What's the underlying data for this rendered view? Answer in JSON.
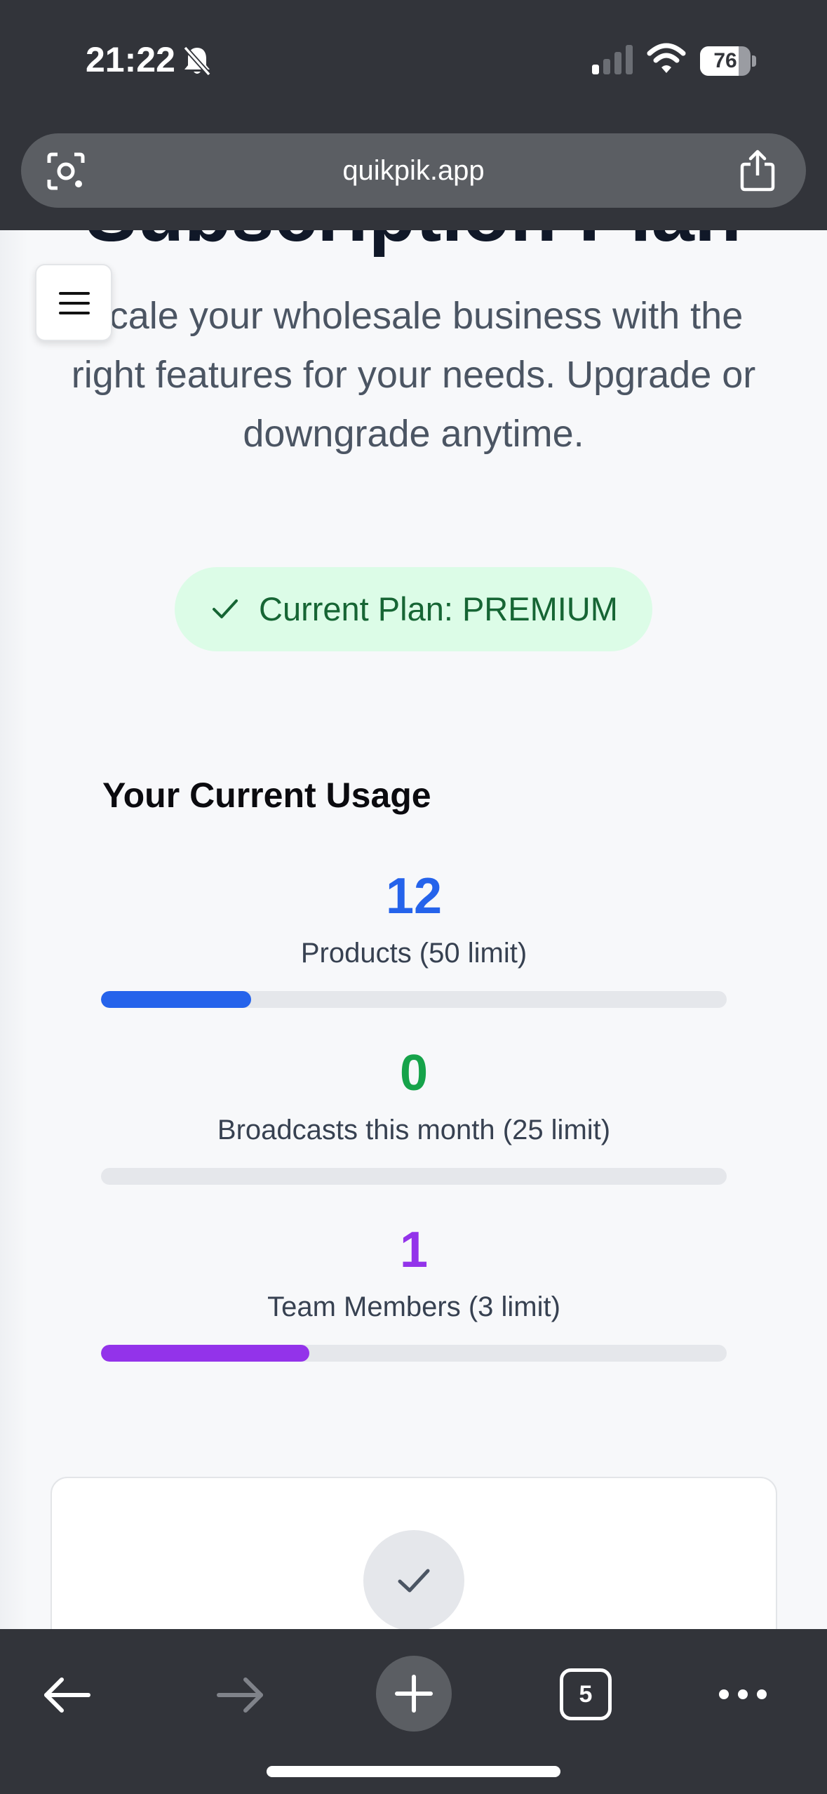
{
  "status_bar": {
    "time": "21:22",
    "battery_level": "76",
    "battery_fraction": 0.76,
    "icons": [
      "bell-slash-icon",
      "cellular-signal-icon",
      "wifi-icon",
      "battery-icon"
    ]
  },
  "browser": {
    "url": "quikpik.app",
    "tab_count": "5",
    "icons": [
      "lens-icon",
      "share-icon",
      "back-icon",
      "forward-icon",
      "plus-icon",
      "tabs-icon",
      "more-icon"
    ]
  },
  "page": {
    "title": "Subscription Plan",
    "subtitle": "Scale your wholesale business with the right features for your needs. Upgrade or downgrade anytime.",
    "current_plan": "Current Plan: PREMIUM",
    "usage_heading": "Your Current Usage"
  },
  "usage": [
    {
      "value": "12",
      "label": "Products (50 limit)",
      "used": 12,
      "limit": 50,
      "color": "#2563eb"
    },
    {
      "value": "0",
      "label": "Broadcasts this month (25 limit)",
      "used": 0,
      "limit": 25,
      "color": "#16a34a"
    },
    {
      "value": "1",
      "label": "Team Members (3 limit)",
      "used": 1,
      "limit": 3,
      "color": "#9333ea"
    }
  ],
  "colors": {
    "chrome": "#32343a",
    "badge_bg": "#dcfce7",
    "badge_text": "#166534",
    "track": "#e5e7eb"
  }
}
